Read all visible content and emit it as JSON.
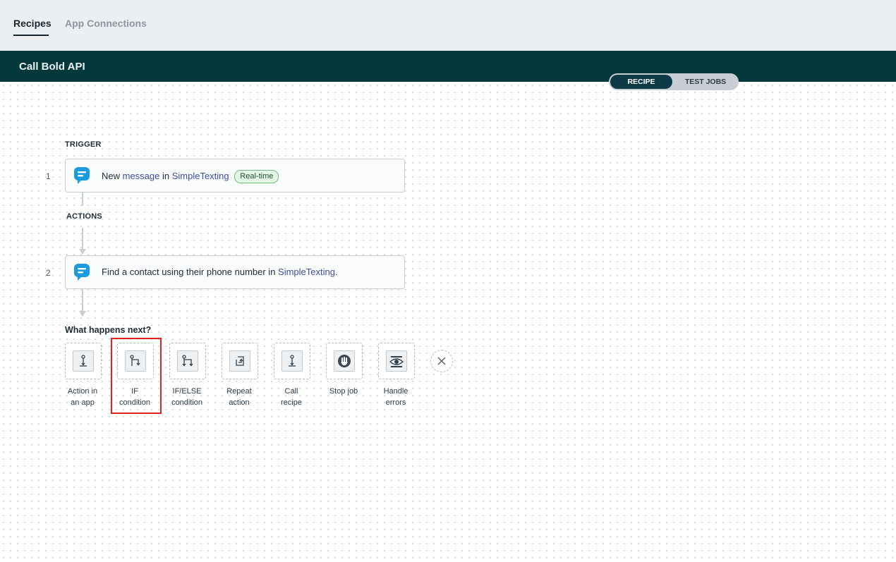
{
  "nav": {
    "tabs": [
      {
        "label": "Recipes",
        "active": true
      },
      {
        "label": "App Connections",
        "active": false
      }
    ]
  },
  "recipe": {
    "title": "Call Bold API",
    "view_toggle": {
      "recipe_label": "RECIPE",
      "test_jobs_label": "TEST JOBS",
      "selected": "RECIPE"
    }
  },
  "trigger": {
    "section_label": "TRIGGER",
    "step_number": "1",
    "app_icon": "simpletexting-icon",
    "text_prefix": "New ",
    "object": "message",
    "text_mid": " in ",
    "app_name": "SimpleTexting",
    "badge": "Real-time"
  },
  "actions": {
    "section_label": "ACTIONS",
    "steps": [
      {
        "step_number": "2",
        "app_icon": "simpletexting-icon",
        "text_prefix": "Find a contact using their phone number in ",
        "app_name": "SimpleTexting",
        "text_suffix": "."
      }
    ]
  },
  "next": {
    "title": "What happens next?",
    "options": [
      {
        "line1": "Action in",
        "line2": "an app",
        "icon": "action-in-app-icon"
      },
      {
        "line1": "IF",
        "line2": "condition",
        "icon": "if-condition-icon"
      },
      {
        "line1": "IF/ELSE",
        "line2": "condition",
        "icon": "if-else-condition-icon"
      },
      {
        "line1": "Repeat",
        "line2": "action",
        "icon": "repeat-action-icon"
      },
      {
        "line1": "Call",
        "line2": "recipe",
        "icon": "call-recipe-icon"
      },
      {
        "line1": "Stop job",
        "line2": "",
        "icon": "stop-job-icon"
      },
      {
        "line1": "Handle",
        "line2": "errors",
        "icon": "handle-errors-icon"
      }
    ],
    "close_icon": "close-icon"
  },
  "colors": {
    "header_bg": "#03393a",
    "nav_bg": "#eceff2",
    "link": "#3a4ea3",
    "badge_border": "#6fbf7c",
    "highlight": "#e0231c",
    "app_icon": "#1a9be0"
  }
}
